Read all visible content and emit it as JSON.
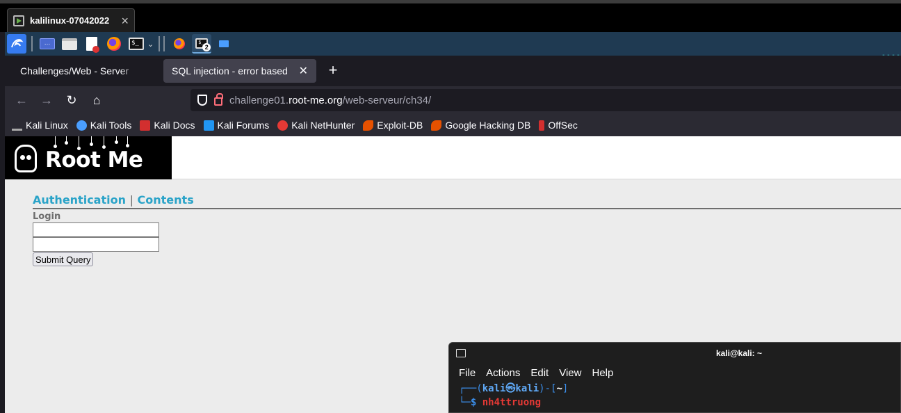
{
  "vm": {
    "tab_title": "kalilinux-07042022"
  },
  "panel": {
    "terminal_badge": "2",
    "dashes": "----"
  },
  "firefox": {
    "tabs": [
      {
        "label": "Challenges/Web - Server"
      },
      {
        "label": "SQL injection - error based"
      }
    ],
    "url": {
      "prefix": "challenge01.",
      "domain": "root-me.org",
      "path": "/web-serveur/ch34/"
    },
    "bookmarks": [
      {
        "label": "Kali Linux",
        "color": "#367bf0"
      },
      {
        "label": "Kali Tools",
        "color": "#4a9eff"
      },
      {
        "label": "Kali Docs",
        "color": "#d32f2f"
      },
      {
        "label": "Kali Forums",
        "color": "#2196f3"
      },
      {
        "label": "Kali NetHunter",
        "color": "#e53935"
      },
      {
        "label": "Exploit-DB",
        "color": "#e65100"
      },
      {
        "label": "Google Hacking DB",
        "color": "#e65100"
      },
      {
        "label": "OffSec",
        "color": "#d32f2f"
      }
    ]
  },
  "page": {
    "logo_text": "Root Me",
    "nav": {
      "authentication": "Authentication",
      "separator": "|",
      "contents": "Contents"
    },
    "login_label": "Login",
    "submit_label": "Submit Query"
  },
  "terminal": {
    "title": "kali@kali: ~",
    "menu": [
      "File",
      "Actions",
      "Edit",
      "View",
      "Help"
    ],
    "prompt_open": "┌──(",
    "prompt_user": "kali㉿kali",
    "prompt_mid": ")-[",
    "prompt_dir": "~",
    "prompt_close": "]",
    "prompt_line2": "└─",
    "prompt_dollar": "$",
    "command": "nh4ttruong"
  }
}
